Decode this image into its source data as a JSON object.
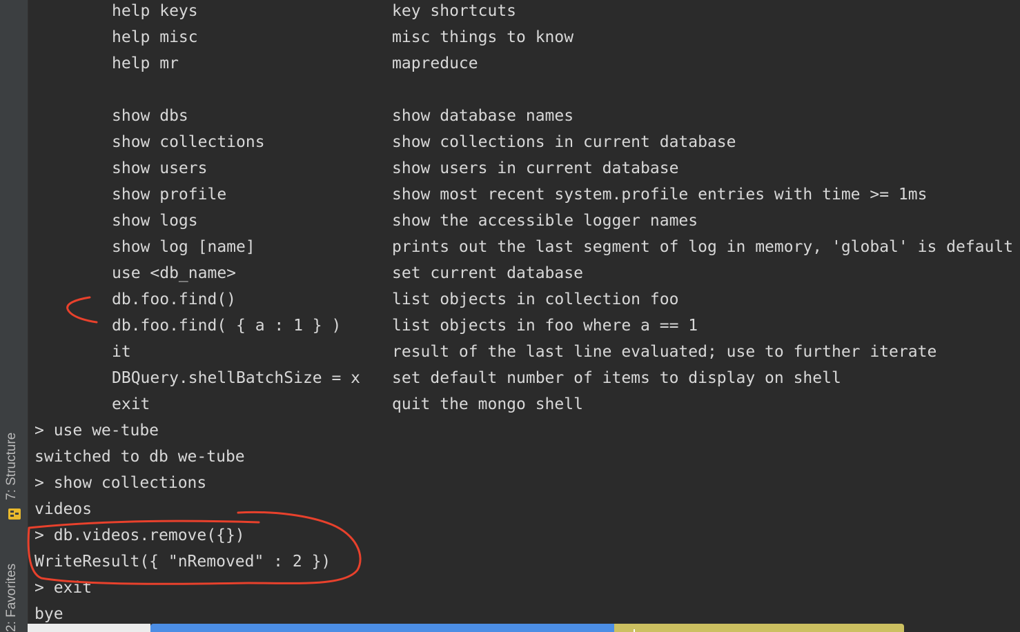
{
  "sidebar": {
    "tabs": [
      {
        "label": "7: Structure"
      },
      {
        "label": "2: Favorites"
      }
    ]
  },
  "terminal": {
    "help_rows": [
      {
        "cmd": "help keys",
        "desc": "key shortcuts"
      },
      {
        "cmd": "help misc",
        "desc": "misc things to know"
      },
      {
        "cmd": "help mr",
        "desc": "mapreduce"
      },
      {
        "cmd": "show dbs",
        "desc": "show database names"
      },
      {
        "cmd": "show collections",
        "desc": "show collections in current database"
      },
      {
        "cmd": "show users",
        "desc": "show users in current database"
      },
      {
        "cmd": "show profile",
        "desc": "show most recent system.profile entries with time >= 1ms"
      },
      {
        "cmd": "show logs",
        "desc": "show the accessible logger names"
      },
      {
        "cmd": "show log [name]",
        "desc": "prints out the last segment of log in memory, 'global' is default"
      },
      {
        "cmd": "use <db_name>",
        "desc": "set current database"
      },
      {
        "cmd": "db.foo.find()",
        "desc": "list objects in collection foo"
      },
      {
        "cmd": "db.foo.find( { a : 1 } )",
        "desc": "list objects in foo where a == 1"
      },
      {
        "cmd": "it",
        "desc": "result of the last line evaluated; use to further iterate"
      },
      {
        "cmd": "DBQuery.shellBatchSize = x",
        "desc": "set default number of items to display on shell"
      },
      {
        "cmd": "exit",
        "desc": "quit the mongo shell"
      }
    ],
    "session_lines": [
      "> use we-tube",
      "switched to db we-tube",
      "> show collections",
      "videos",
      "> db.videos.remove({})",
      "WriteResult({ \"nRemoved\" : 2 })",
      "> exit",
      "bye"
    ]
  },
  "colors": {
    "background": "#2b2b2b",
    "text": "#d8d8d8",
    "annotation": "#e8412c",
    "status_blue": "#4c8ee5",
    "status_yellow": "#ccc061"
  }
}
